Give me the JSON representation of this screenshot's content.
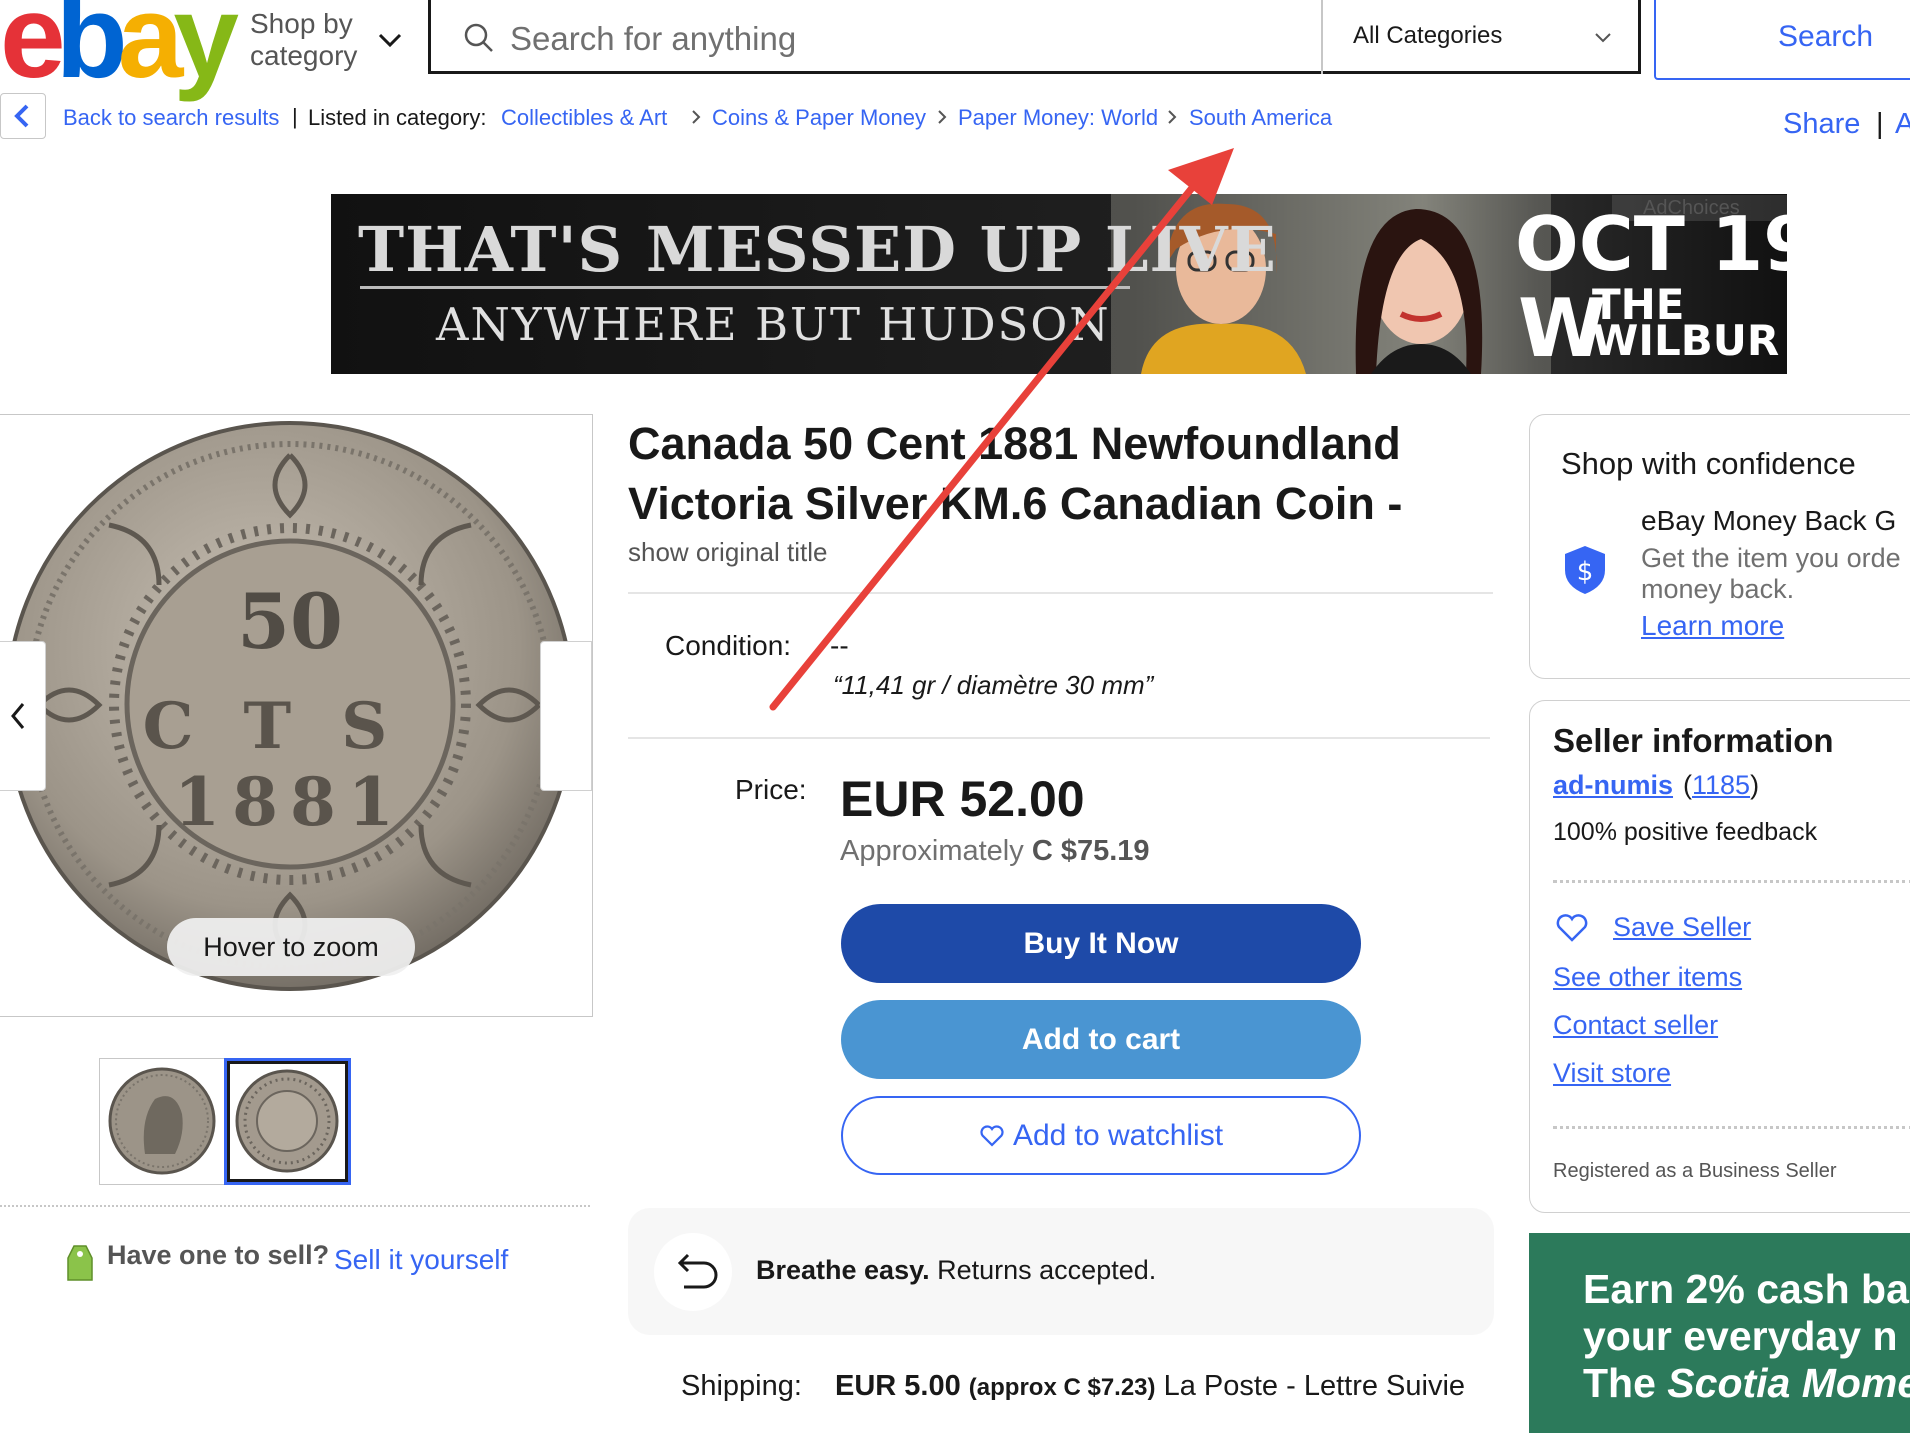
{
  "header": {
    "logo_letters": [
      "e",
      "b",
      "a",
      "y"
    ],
    "logo_colors": [
      "#e53238",
      "#0064d2",
      "#f5af02",
      "#86b817"
    ],
    "shop_by_line1": "Shop by",
    "shop_by_line2": "category",
    "search_placeholder": "Search for anything",
    "category_selected": "All Categories",
    "search_button": "Search"
  },
  "breadcrumb": {
    "back_label": "Back to search results",
    "separator": "|",
    "listed_in": "Listed in category:",
    "items": [
      "Collectibles & Art",
      "Coins & Paper Money",
      "Paper Money: World",
      "South America"
    ],
    "share": "Share",
    "share_separator": "|",
    "share_next": "A"
  },
  "ad": {
    "choices": "AdChoices",
    "line1": "THAT'S MESSED UP LIVE",
    "line2": "ANYWHERE BUT HUDSON",
    "date": "OCT 19",
    "venue_line1": "THE",
    "venue_line2": "WILBUR",
    "venue_logo": "W"
  },
  "gallery": {
    "coin_value": "50",
    "coin_cts": "CTS",
    "coin_year": "1881",
    "hover_zoom": "Hover to zoom",
    "have_one": "Have one to sell?",
    "sell_it": "Sell it yourself"
  },
  "item": {
    "title": "Canada 50 Cent 1881 Newfoundland Victoria Silver KM.6 Canadian Coin -",
    "show_original": "show original title",
    "condition_label": "Condition:",
    "condition_value": "--",
    "condition_note": "“11,41 gr / diamètre 30 mm”",
    "price_label": "Price:",
    "price": "EUR 52.00",
    "approx_prefix": "Approximately",
    "approx_value": "C $75.19",
    "buy_now": "Buy It Now",
    "add_to_cart": "Add to cart",
    "add_to_watchlist": "Add to watchlist",
    "returns_bold": "Breathe easy.",
    "returns_text": "Returns accepted.",
    "shipping_label": "Shipping:",
    "shipping_value": "EUR 5.00",
    "shipping_approx": "(approx C $7.23)",
    "shipping_service": "La Poste - Lettre Suivie"
  },
  "confidence": {
    "title": "Shop with confidence",
    "guarantee_title": "eBay Money Back G",
    "guarantee_desc1": "Get the item you orde",
    "guarantee_desc2": "money back.",
    "learn_more": "Learn more"
  },
  "seller": {
    "title": "Seller information",
    "name": "ad-numis",
    "count_open": "(",
    "count": "1185",
    "count_close": ")",
    "feedback": "100% positive feedback",
    "save_seller": "Save Seller",
    "see_other": "See other items",
    "contact": "Contact seller",
    "visit_store": "Visit store",
    "business": "Registered as a Business Seller"
  },
  "promo": {
    "line1": "Earn 2% cash ba",
    "line2": "your everyday n",
    "line3_prefix": "The ",
    "line3_italic": "Scotia Mome"
  },
  "colors": {
    "link_blue": "#3665f3",
    "buy_now": "#1e4aa8",
    "add_to_cart": "#4a95d2",
    "promo_green": "#2c7a5b",
    "annotation_arrow": "#e8413a"
  }
}
